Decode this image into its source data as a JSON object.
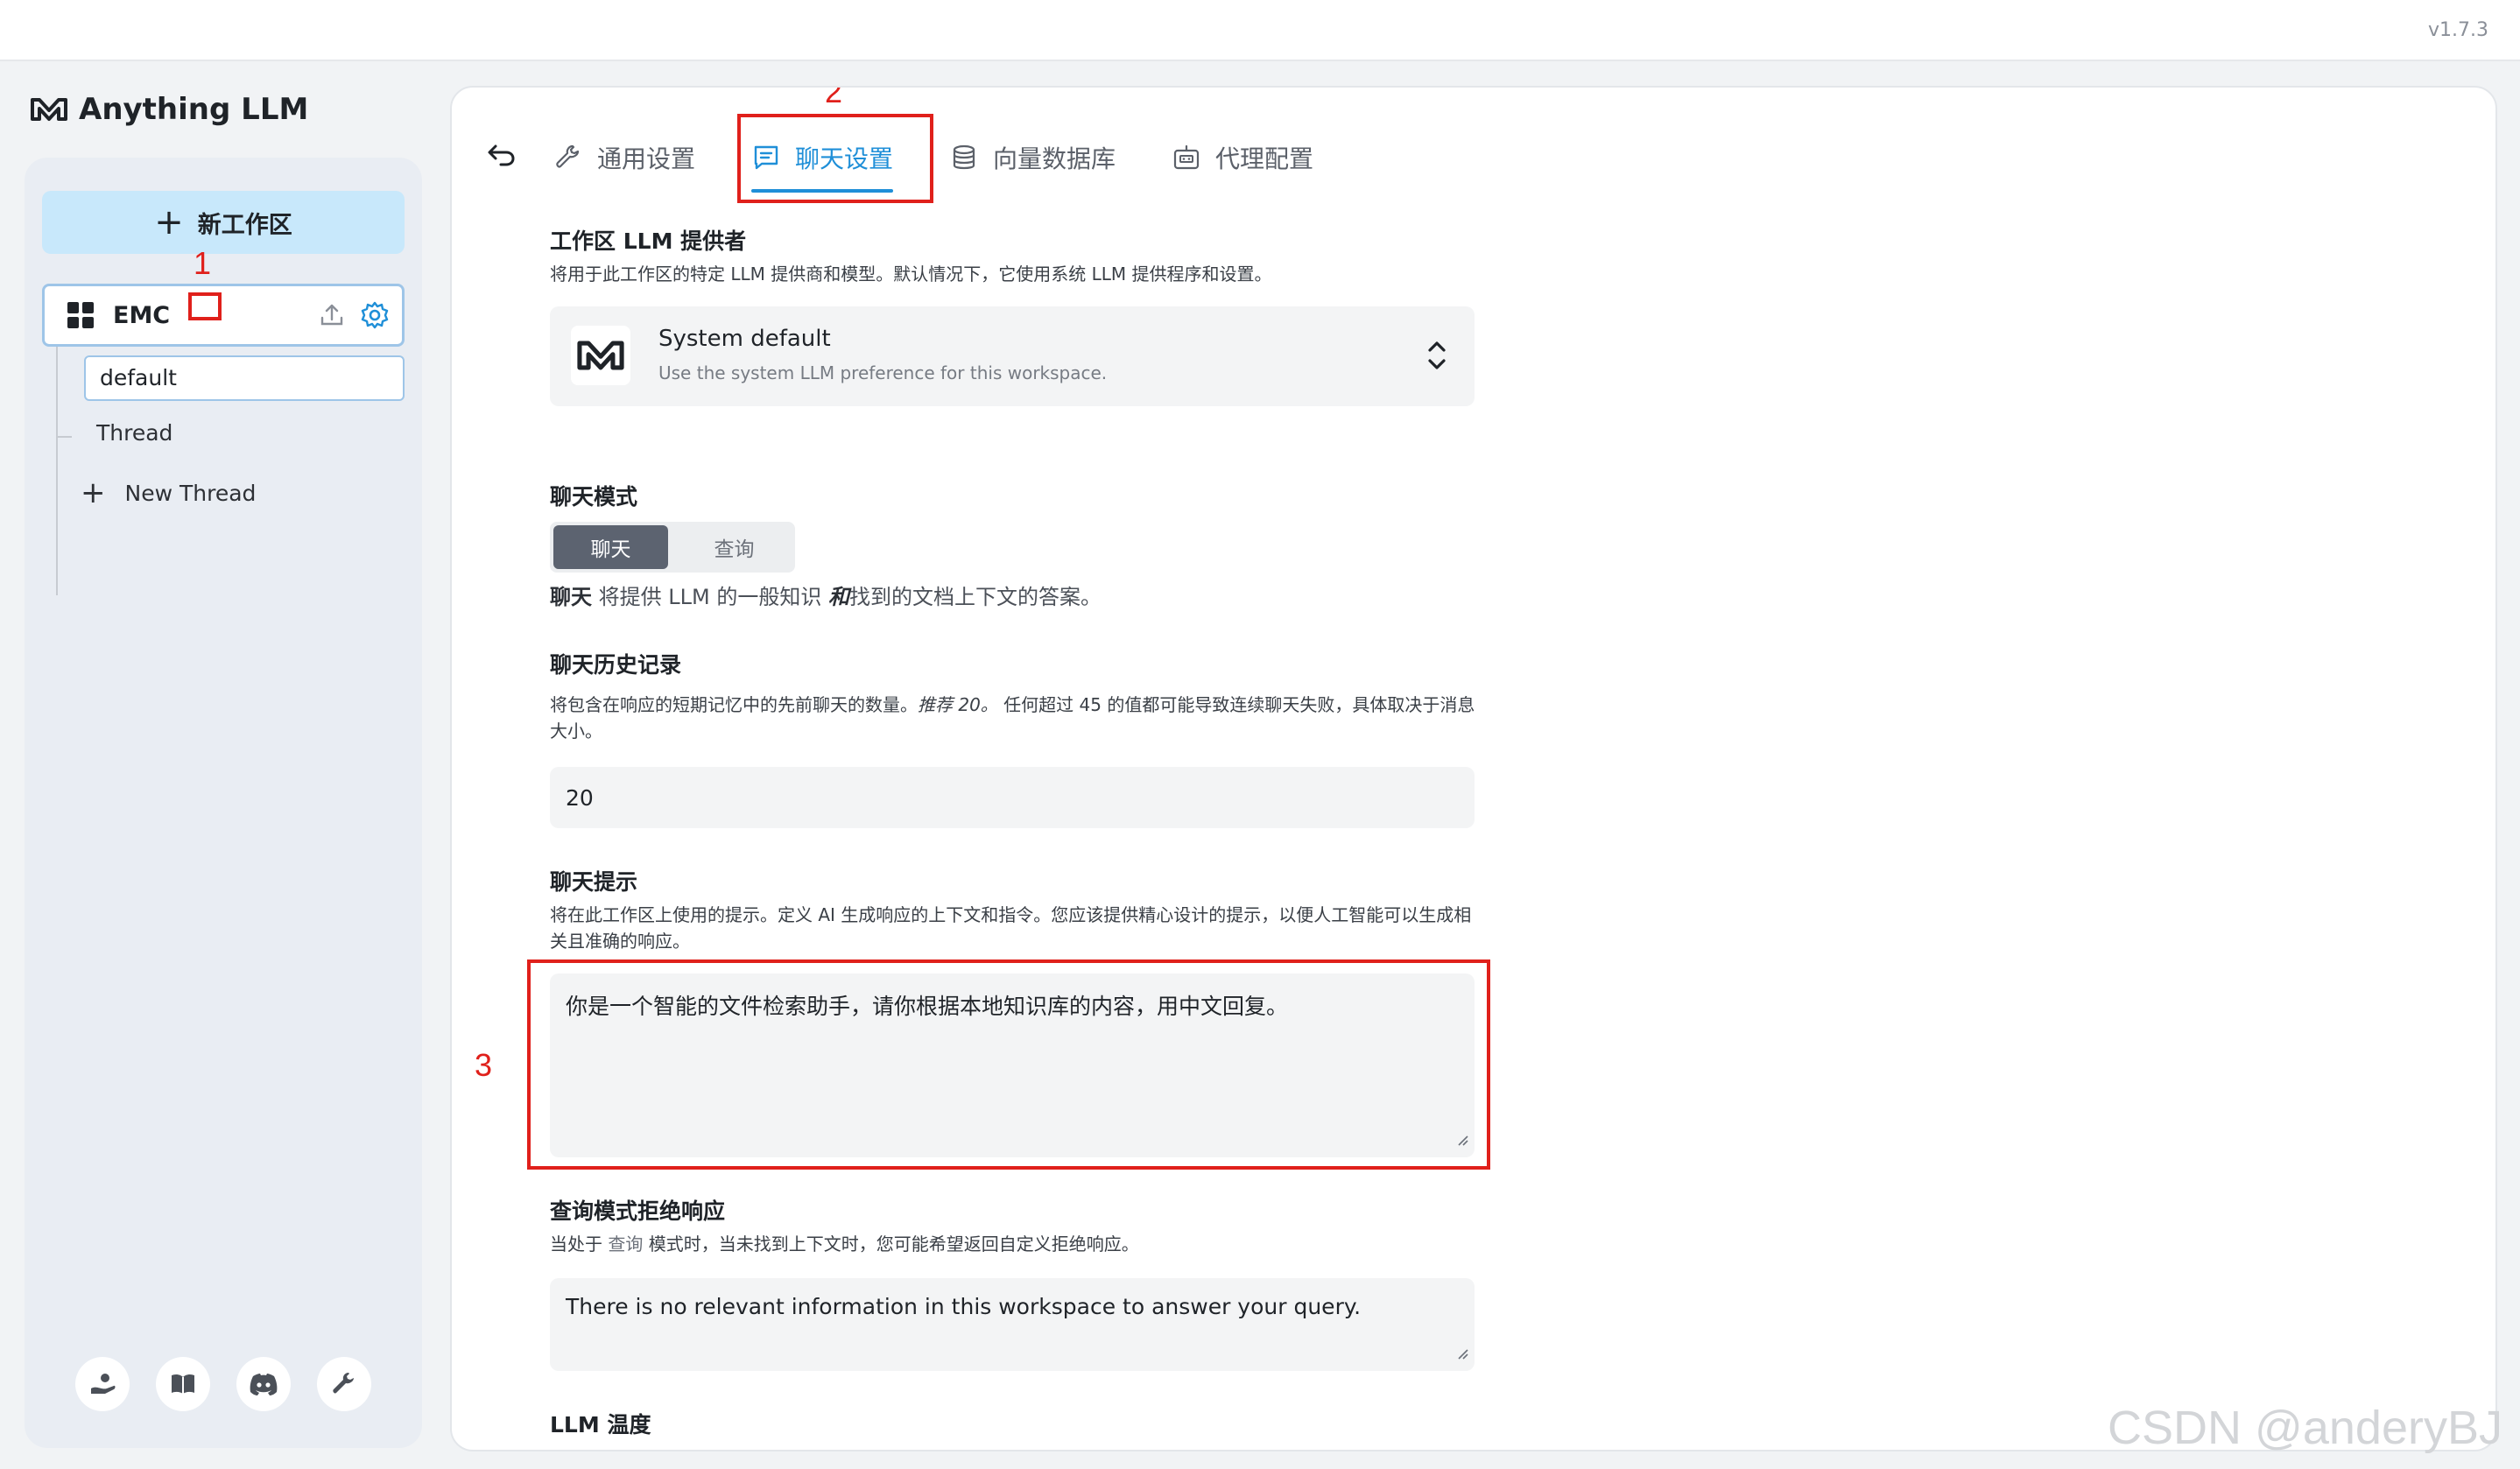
{
  "app": {
    "name": "Anything LLM",
    "version": "v1.7.3"
  },
  "sidebar": {
    "new_workspace_label": "新工作区",
    "workspace": {
      "name": "EMC"
    },
    "threads": [
      {
        "label": "default"
      },
      {
        "label": "Thread"
      }
    ],
    "new_thread_label": "New Thread",
    "footer_icons": [
      "community-icon",
      "book-icon",
      "discord-icon",
      "wrench-icon"
    ]
  },
  "tabs": [
    {
      "label": "通用设置",
      "icon": "wrench-icon"
    },
    {
      "label": "聊天设置",
      "icon": "chat-icon",
      "active": true
    },
    {
      "label": "向量数据库",
      "icon": "database-icon"
    },
    {
      "label": "代理配置",
      "icon": "robot-icon"
    }
  ],
  "annotations": {
    "n1": "1",
    "n2": "2",
    "n3": "3",
    "color": "#e0201b"
  },
  "llm_provider": {
    "title": "工作区 LLM 提供者",
    "description": "将用于此工作区的特定 LLM 提供商和模型。默认情况下，它使用系统 LLM 提供程序和设置。",
    "selected_name": "System default",
    "selected_desc": "Use the system LLM preference for this workspace."
  },
  "chat_mode": {
    "title": "聊天模式",
    "options": [
      "聊天",
      "查询"
    ],
    "selected": "聊天",
    "desc_bold": "聊天",
    "desc_middle": " 将提供 LLM 的一般知识 ",
    "desc_italic": "和",
    "desc_end": "找到的文档上下文的答案。"
  },
  "chat_history": {
    "title": "聊天历史记录",
    "desc_start": "将包含在响应的短期记忆中的先前聊天的数量。",
    "desc_italic": "推荐 20。",
    "desc_end": " 任何超过 45 的值都可能导致连续聊天失败，具体取决于消息大小。",
    "value": "20"
  },
  "chat_prompt": {
    "title": "聊天提示",
    "description": "将在此工作区上使用的提示。定义 AI 生成响应的上下文和指令。您应该提供精心设计的提示，以便人工智能可以生成相关且准确的响应。",
    "value": "你是一个智能的文件检索助手，请你根据本地知识库的内容，用中文回复。"
  },
  "query_refusal": {
    "title": "查询模式拒绝响应",
    "desc_start": "当处于 ",
    "desc_code": "查询",
    "desc_end": " 模式时，当未找到上下文时，您可能希望返回自定义拒绝响应。",
    "value": "There is no relevant information in this workspace to answer your query."
  },
  "llm_temperature": {
    "title": "LLM 温度"
  },
  "watermark": "CSDN @anderyBJ",
  "colors": {
    "accent": "#1f8fd8",
    "sidebar_bg": "#e9edf3",
    "new_ws_bg": "#c8e8fb"
  }
}
